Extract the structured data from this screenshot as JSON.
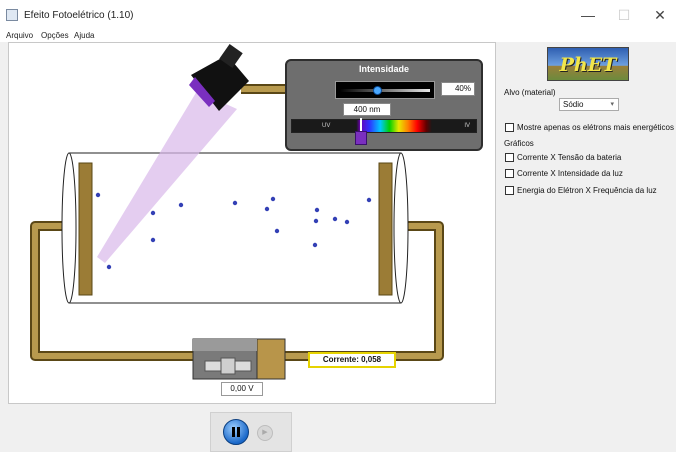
{
  "window": {
    "title": "Efeito Fotoelétrico (1.10)",
    "minimize": "—",
    "maximize": "☐",
    "close": "✕"
  },
  "menu": [
    "Arquivo",
    "Opções",
    "Ajuda"
  ],
  "intensity": {
    "title": "Intensidade",
    "value_percent": 40,
    "value_label": "40%"
  },
  "wavelength": {
    "value_label": "400 nm",
    "uv_label": "UV",
    "ir_label": "IV"
  },
  "circuit": {
    "current_label": "Corrente: 0,058",
    "voltage_label": "0,00 V"
  },
  "controls": {
    "pause_icon": "pause-icon",
    "step_icon": "step-icon"
  },
  "sidebar": {
    "logo_text": "PhET",
    "target_label": "Alvo (material)",
    "target_value": "Sódio",
    "only_energetic": "Mostre apenas os elétrons mais energéticos",
    "graphs_title": "Gráficos",
    "graph_options": [
      "Corrente X Tensão da bateria",
      "Corrente X Intensidade da luz",
      "Energia do Elétron X Frequência da luz"
    ]
  },
  "colors": {
    "light_beam": "#d9b8ea",
    "wire": "#9b7c36",
    "electron": "#3340b5",
    "current_border": "#e6d300"
  }
}
